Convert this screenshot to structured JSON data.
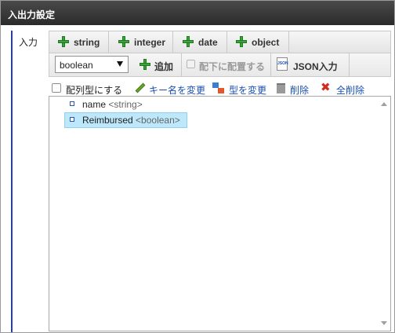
{
  "dialog": {
    "title": "入出力設定"
  },
  "section": {
    "label": "入力"
  },
  "type_buttons": [
    {
      "label": "string"
    },
    {
      "label": "integer"
    },
    {
      "label": "date"
    },
    {
      "label": "object"
    }
  ],
  "toolbar": {
    "selected_type": "boolean",
    "add_label": "追加",
    "place_under_label": "配下に配置する",
    "json_input_label": "JSON入力",
    "json_icon_text": "JSON"
  },
  "actions": {
    "array_label": "配列型にする",
    "rename_key_label": "キー名を変更",
    "change_type_label": "型を変更",
    "delete_label": "削除",
    "delete_all_label": "全削除",
    "delete_all_icon": "✖"
  },
  "tree": {
    "nodes": [
      {
        "name": "name",
        "type": "<string>",
        "selected": false
      },
      {
        "name": "Reimbursed",
        "type": "<boolean>",
        "selected": true
      }
    ]
  },
  "colors": {
    "title_bar": "#3a3a3a",
    "accent_line": "#2a3f9e",
    "link": "#1a4fb3",
    "plus_icon": "#3aa33a",
    "selected_row": "#bde8fb"
  }
}
